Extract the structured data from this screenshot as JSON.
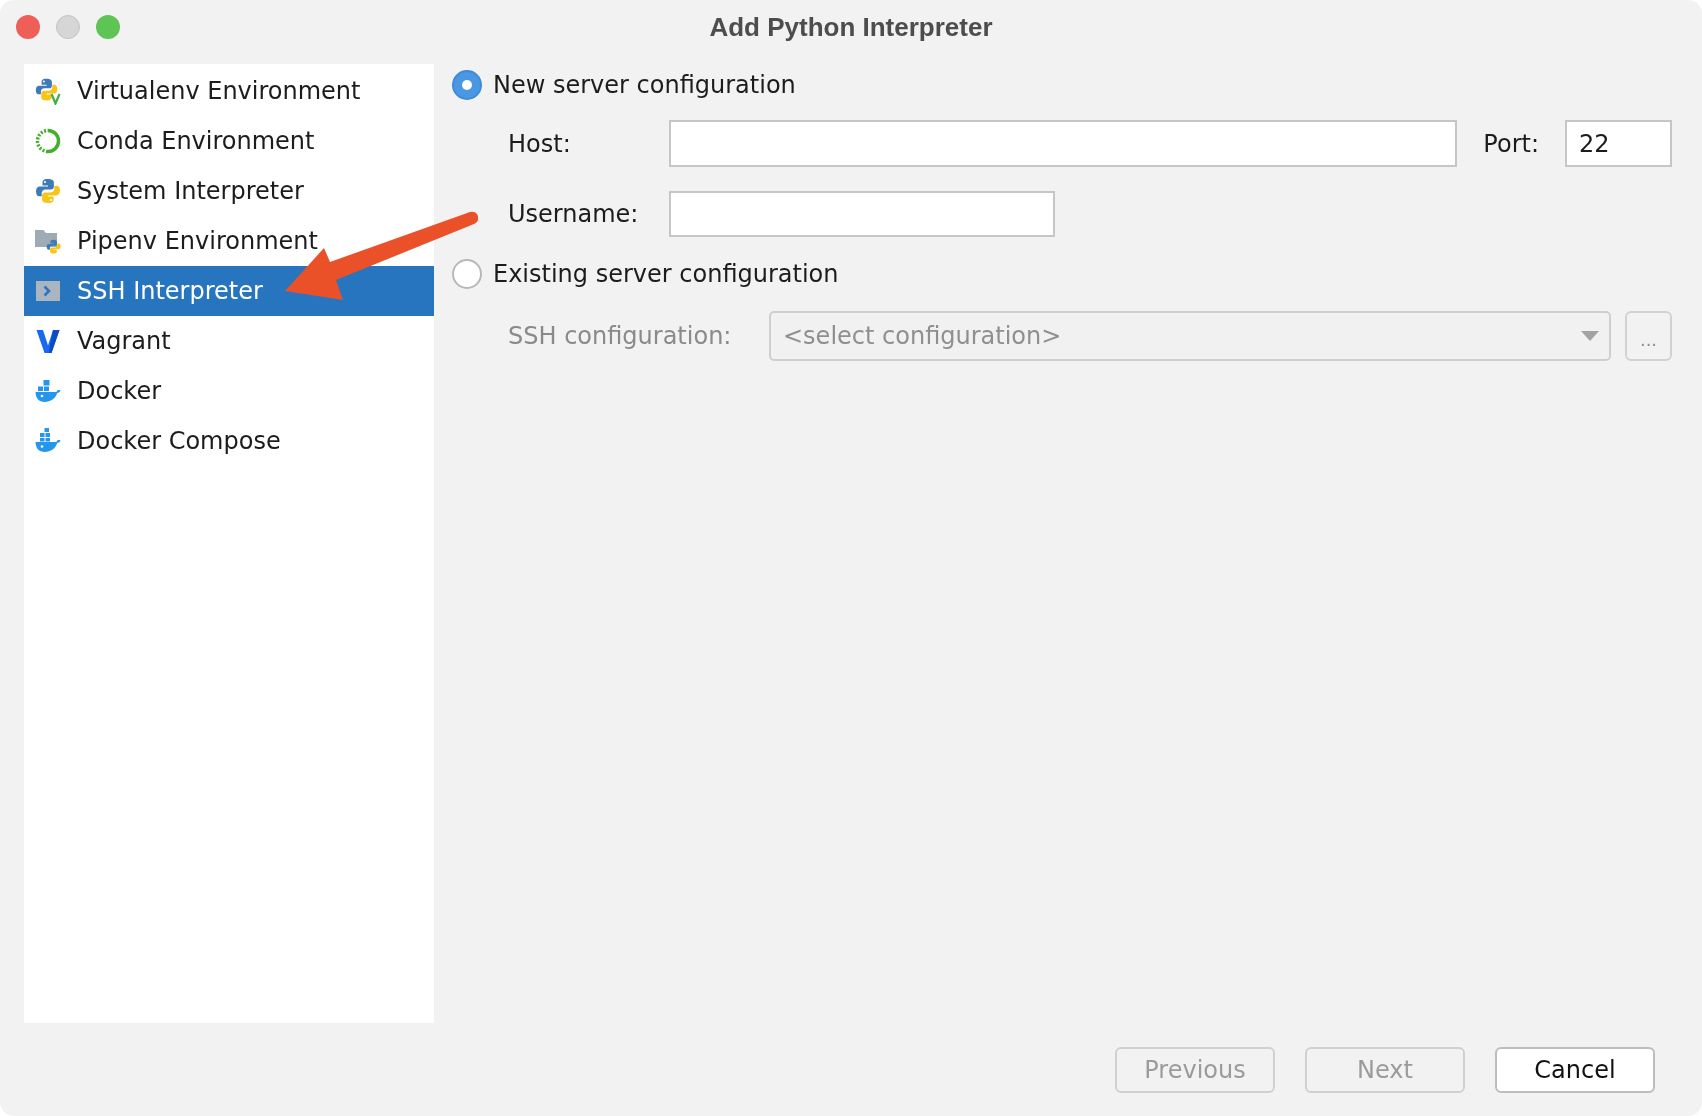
{
  "window": {
    "title": "Add Python Interpreter",
    "controls": [
      {
        "kind": "close",
        "disabled": false
      },
      {
        "kind": "minimize",
        "disabled": true
      },
      {
        "kind": "zoom",
        "disabled": false
      }
    ]
  },
  "sidebar": {
    "items": [
      {
        "label": "Virtualenv Environment",
        "kind": "virtualenv",
        "selected": false
      },
      {
        "label": "Conda Environment",
        "kind": "conda",
        "selected": false
      },
      {
        "label": "System Interpreter",
        "kind": "system",
        "selected": false
      },
      {
        "label": "Pipenv Environment",
        "kind": "pipenv",
        "selected": false
      },
      {
        "label": "SSH Interpreter",
        "kind": "ssh",
        "selected": true
      },
      {
        "label": "Vagrant",
        "kind": "vagrant",
        "selected": false
      },
      {
        "label": "Docker",
        "kind": "docker",
        "selected": false
      },
      {
        "label": "Docker Compose",
        "kind": "docker_compose",
        "selected": false
      }
    ]
  },
  "server_options": [
    {
      "label": "New server configuration",
      "selected": true
    },
    {
      "label": "Existing server configuration",
      "selected": false
    }
  ],
  "new_server": {
    "host": {
      "label": "Host:"
    },
    "port": {
      "label": "Port:",
      "value": "22"
    },
    "username": {
      "label": "Username:"
    }
  },
  "existing_server": {
    "ssh_configuration": {
      "label": "SSH configuration:",
      "placeholder": "<select configuration>",
      "disabled": true
    },
    "browse_button": {
      "label": "...",
      "disabled": true
    }
  },
  "buttons": [
    {
      "label": "Previous",
      "disabled": true
    },
    {
      "label": "Next",
      "disabled": true
    },
    {
      "label": "Cancel",
      "disabled": false
    }
  ]
}
